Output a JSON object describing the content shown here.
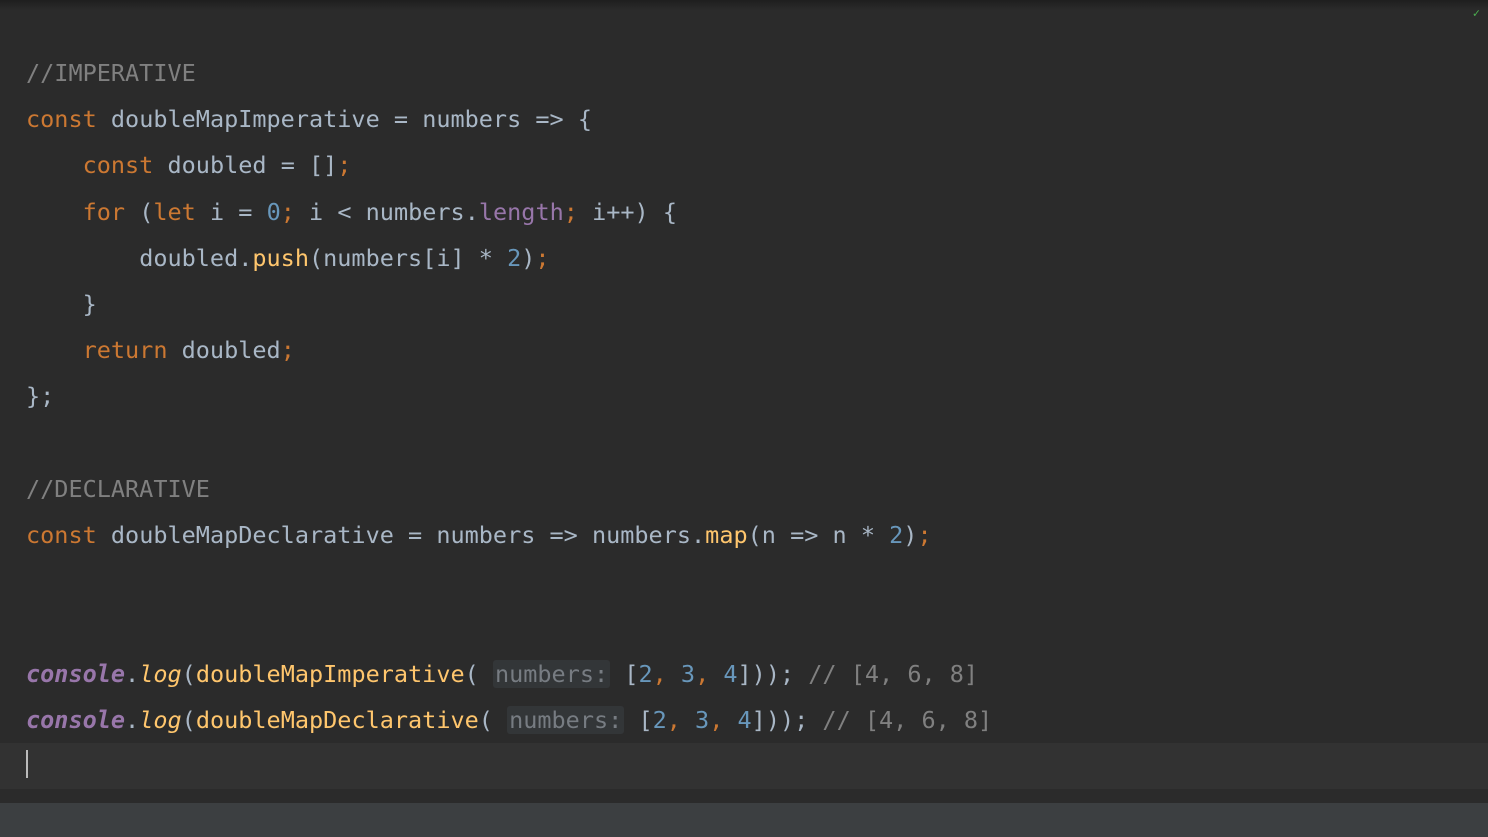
{
  "editor": {
    "checkIcon": "✓",
    "hintLabel": "numbers:",
    "tokens": {
      "commentImperative": "//IMPERATIVE",
      "commentDeclarative": "//DECLARATIVE",
      "const": "const",
      "for": "for",
      "let": "let",
      "return": "return",
      "doubleMapImperative": "doubleMapImperative",
      "doubleMapDeclarative": "doubleMapDeclarative",
      "numbers": "numbers",
      "doubled": "doubled",
      "i": "i",
      "n": "n",
      "length": "length",
      "push": "push",
      "map": "map",
      "console": "console",
      "log": "log",
      "eq": " = ",
      "arrow": " => ",
      "openBrace": "{",
      "closeBrace": "}",
      "openParen": "(",
      "closeParen": ")",
      "openBracket": "[",
      "closeBracket": "]",
      "emptyArr": "[]",
      "semi": ";",
      "comma": ", ",
      "dot": ".",
      "star": " * ",
      "lt": " < ",
      "inc": "++",
      "zero": "0",
      "two": "2",
      "three": "3",
      "four": "4",
      "commentResult": "// [4, 6, 8]",
      "closeBraceSemi": "};",
      "closeParenParenSemi": "));",
      "indent1": "    ",
      "indent2": "        ",
      "space": " "
    }
  }
}
